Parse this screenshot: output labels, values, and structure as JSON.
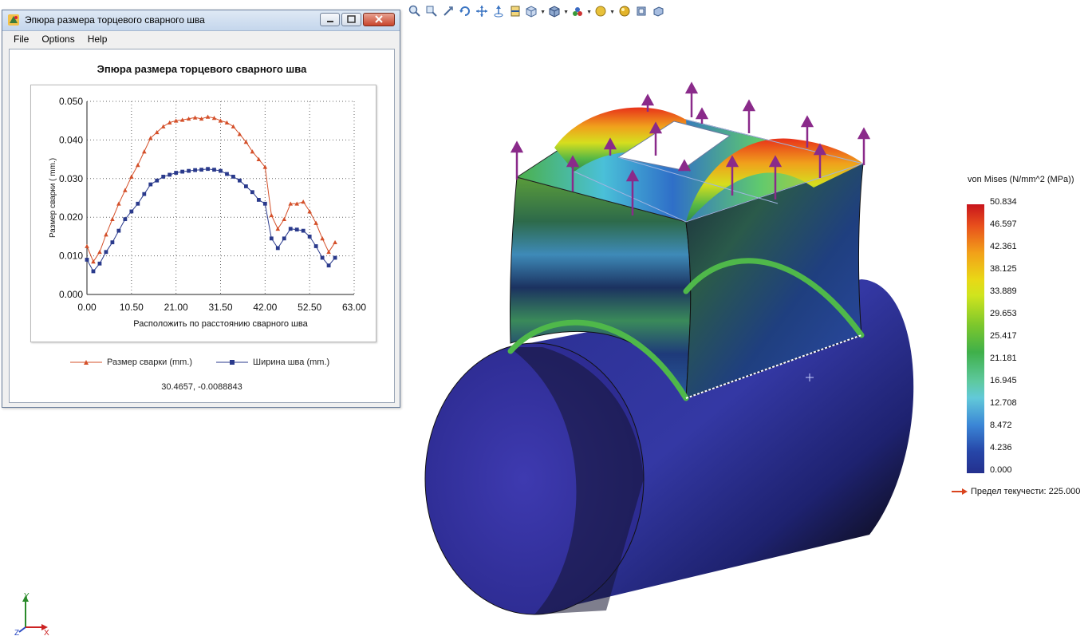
{
  "window": {
    "title": "Эпюра размера торцевого сварного шва",
    "menu": [
      "File",
      "Options",
      "Help"
    ]
  },
  "chart_data": {
    "type": "line",
    "title": "Эпюра размера торцевого сварного шва",
    "xlabel": "Расположить по расстоянию сварного шва",
    "ylabel": "Размер сварки ( mm.)",
    "xlim": [
      0,
      63
    ],
    "ylim": [
      0,
      0.05
    ],
    "xticks": [
      "0.00",
      "10.50",
      "21.00",
      "31.50",
      "42.00",
      "52.50",
      "63.00"
    ],
    "yticks": [
      "0.000",
      "0.010",
      "0.020",
      "0.030",
      "0.040",
      "0.050"
    ],
    "grid": true,
    "legend_position": "bottom",
    "series": [
      {
        "name": "Размер сварки (mm.)",
        "color": "#d4502a",
        "marker": "triangle",
        "x": [
          0,
          1.5,
          3,
          4.5,
          6,
          7.5,
          9,
          10.5,
          12,
          13.5,
          15,
          16.5,
          18,
          19.5,
          21,
          22.5,
          24,
          25.5,
          27,
          28.5,
          30,
          31.5,
          33,
          34.5,
          36,
          37.5,
          39,
          40.5,
          42,
          43.5,
          45,
          46.5,
          48,
          49.5,
          51,
          52.5,
          54,
          55.5,
          57,
          58.5
        ],
        "y": [
          0.0125,
          0.0085,
          0.011,
          0.0155,
          0.0195,
          0.0235,
          0.027,
          0.0305,
          0.0335,
          0.037,
          0.0405,
          0.042,
          0.0435,
          0.0445,
          0.045,
          0.0452,
          0.0455,
          0.0458,
          0.0455,
          0.046,
          0.0457,
          0.045,
          0.0445,
          0.0435,
          0.0415,
          0.0395,
          0.037,
          0.035,
          0.033,
          0.0205,
          0.017,
          0.0195,
          0.0235,
          0.0235,
          0.024,
          0.0215,
          0.0185,
          0.0145,
          0.011,
          0.0135
        ]
      },
      {
        "name": "Ширина шва (mm.)",
        "color": "#2a3a8c",
        "marker": "square",
        "x": [
          0,
          1.5,
          3,
          4.5,
          6,
          7.5,
          9,
          10.5,
          12,
          13.5,
          15,
          16.5,
          18,
          19.5,
          21,
          22.5,
          24,
          25.5,
          27,
          28.5,
          30,
          31.5,
          33,
          34.5,
          36,
          37.5,
          39,
          40.5,
          42,
          43.5,
          45,
          46.5,
          48,
          49.5,
          51,
          52.5,
          54,
          55.5,
          57,
          58.5
        ],
        "y": [
          0.009,
          0.006,
          0.008,
          0.011,
          0.0135,
          0.0165,
          0.0195,
          0.0215,
          0.0235,
          0.026,
          0.0285,
          0.0295,
          0.0305,
          0.031,
          0.0315,
          0.0318,
          0.032,
          0.0322,
          0.0323,
          0.0325,
          0.0323,
          0.032,
          0.0312,
          0.0305,
          0.0295,
          0.028,
          0.0265,
          0.0245,
          0.0235,
          0.0145,
          0.012,
          0.0145,
          0.017,
          0.0168,
          0.0165,
          0.015,
          0.0125,
          0.0095,
          0.0075,
          0.0095
        ]
      }
    ]
  },
  "cursor_readout": "30.4657, -0.0088843",
  "toolbar": {
    "icons": [
      "zoom-fit-icon",
      "zoom-window-icon",
      "zoom-in-out-icon",
      "rotate-icon",
      "pan-icon",
      "move-icon",
      "section-view-icon",
      "view-orientation-icon",
      "display-style-icon",
      "appearance-icon",
      "light-icon",
      "sphere-icon",
      "cube-view-icon",
      "iso-view-icon"
    ]
  },
  "colorbar": {
    "title": "von Mises (N/mm^2 (MPa))",
    "ticks": [
      "50.834",
      "46.597",
      "42.361",
      "38.125",
      "33.889",
      "29.653",
      "25.417",
      "21.181",
      "16.945",
      "12.708",
      "8.472",
      "4.236",
      "0.000"
    ],
    "yield_label": "Предел текучести: 225.000",
    "yield_color": "#d9441e"
  },
  "triad": {
    "y": "Y",
    "x": "X",
    "z": "Z"
  }
}
